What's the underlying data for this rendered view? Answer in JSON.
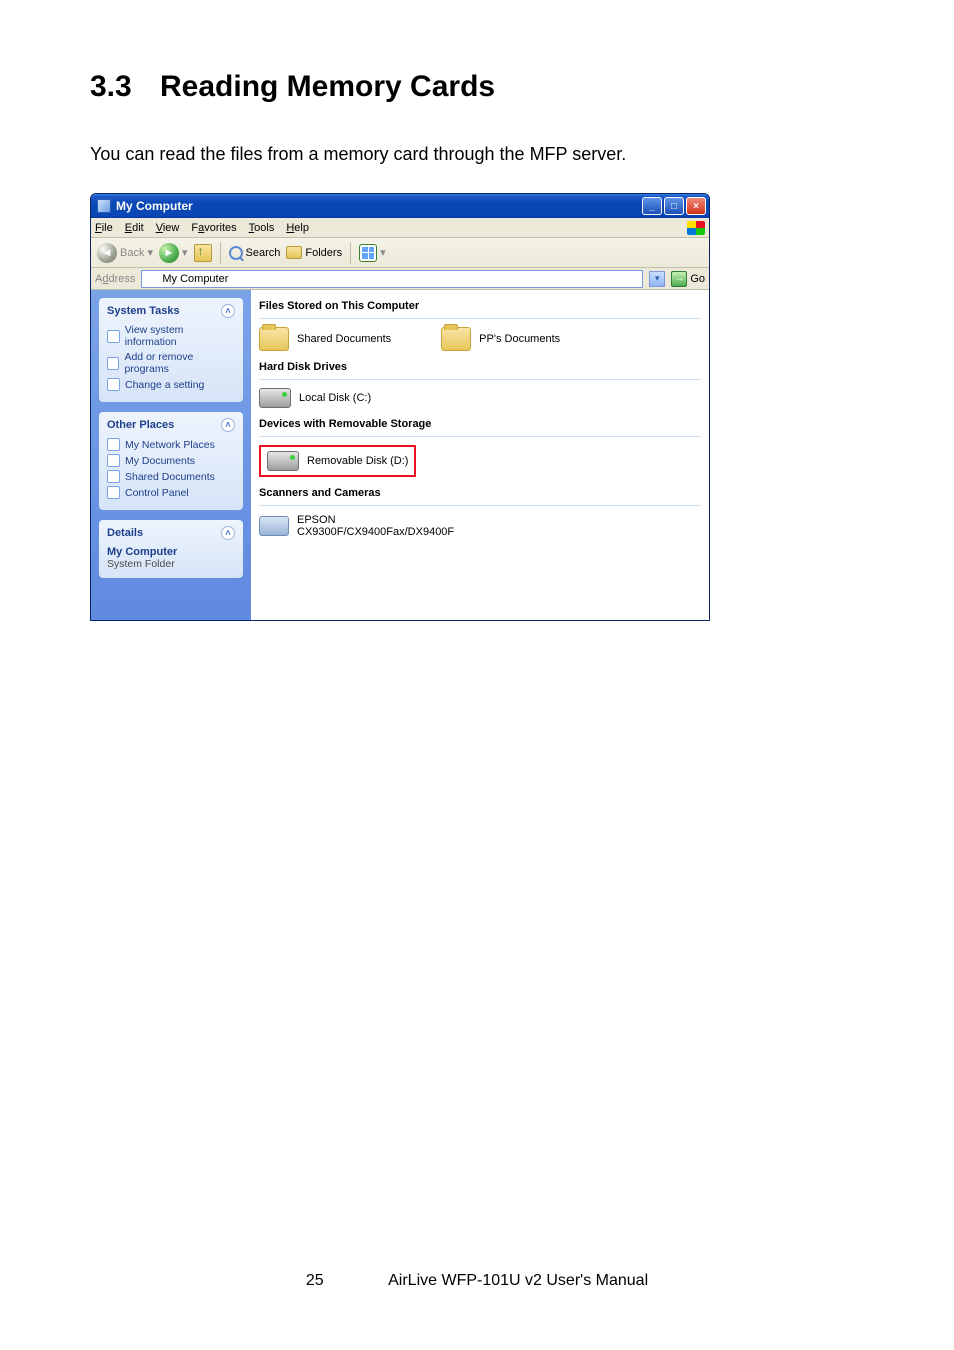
{
  "heading": {
    "number": "3.3",
    "title": "Reading Memory Cards"
  },
  "intro": "You can read the files from a memory card through the MFP server.",
  "footer": {
    "page": "25",
    "text": "AirLive WFP-101U v2 User's Manual"
  },
  "xp": {
    "title": "My Computer",
    "menu": {
      "file": "File",
      "edit": "Edit",
      "view": "View",
      "favorites": "Favorites",
      "tools": "Tools",
      "help": "Help"
    },
    "toolbar": {
      "back": "Back",
      "search": "Search",
      "folders": "Folders"
    },
    "address": {
      "label": "Address",
      "value": "My Computer",
      "go": "Go"
    },
    "sidebar": {
      "system_tasks": {
        "title": "System Tasks",
        "items": [
          "View system information",
          "Add or remove programs",
          "Change a setting"
        ]
      },
      "other_places": {
        "title": "Other Places",
        "items": [
          "My Network Places",
          "My Documents",
          "Shared Documents",
          "Control Panel"
        ]
      },
      "details": {
        "title": "Details",
        "name": "My Computer",
        "type": "System Folder"
      }
    },
    "main": {
      "group1": {
        "title": "Files Stored on This Computer",
        "items": [
          "Shared Documents",
          "PP's Documents"
        ]
      },
      "group2": {
        "title": "Hard Disk Drives",
        "items": [
          "Local Disk (C:)"
        ]
      },
      "group3": {
        "title": "Devices with Removable Storage",
        "items": [
          "Removable Disk (D:)"
        ]
      },
      "group4": {
        "title": "Scanners and Cameras",
        "items": [
          "EPSON CX9300F/CX9400Fax/DX9400F"
        ]
      }
    }
  }
}
